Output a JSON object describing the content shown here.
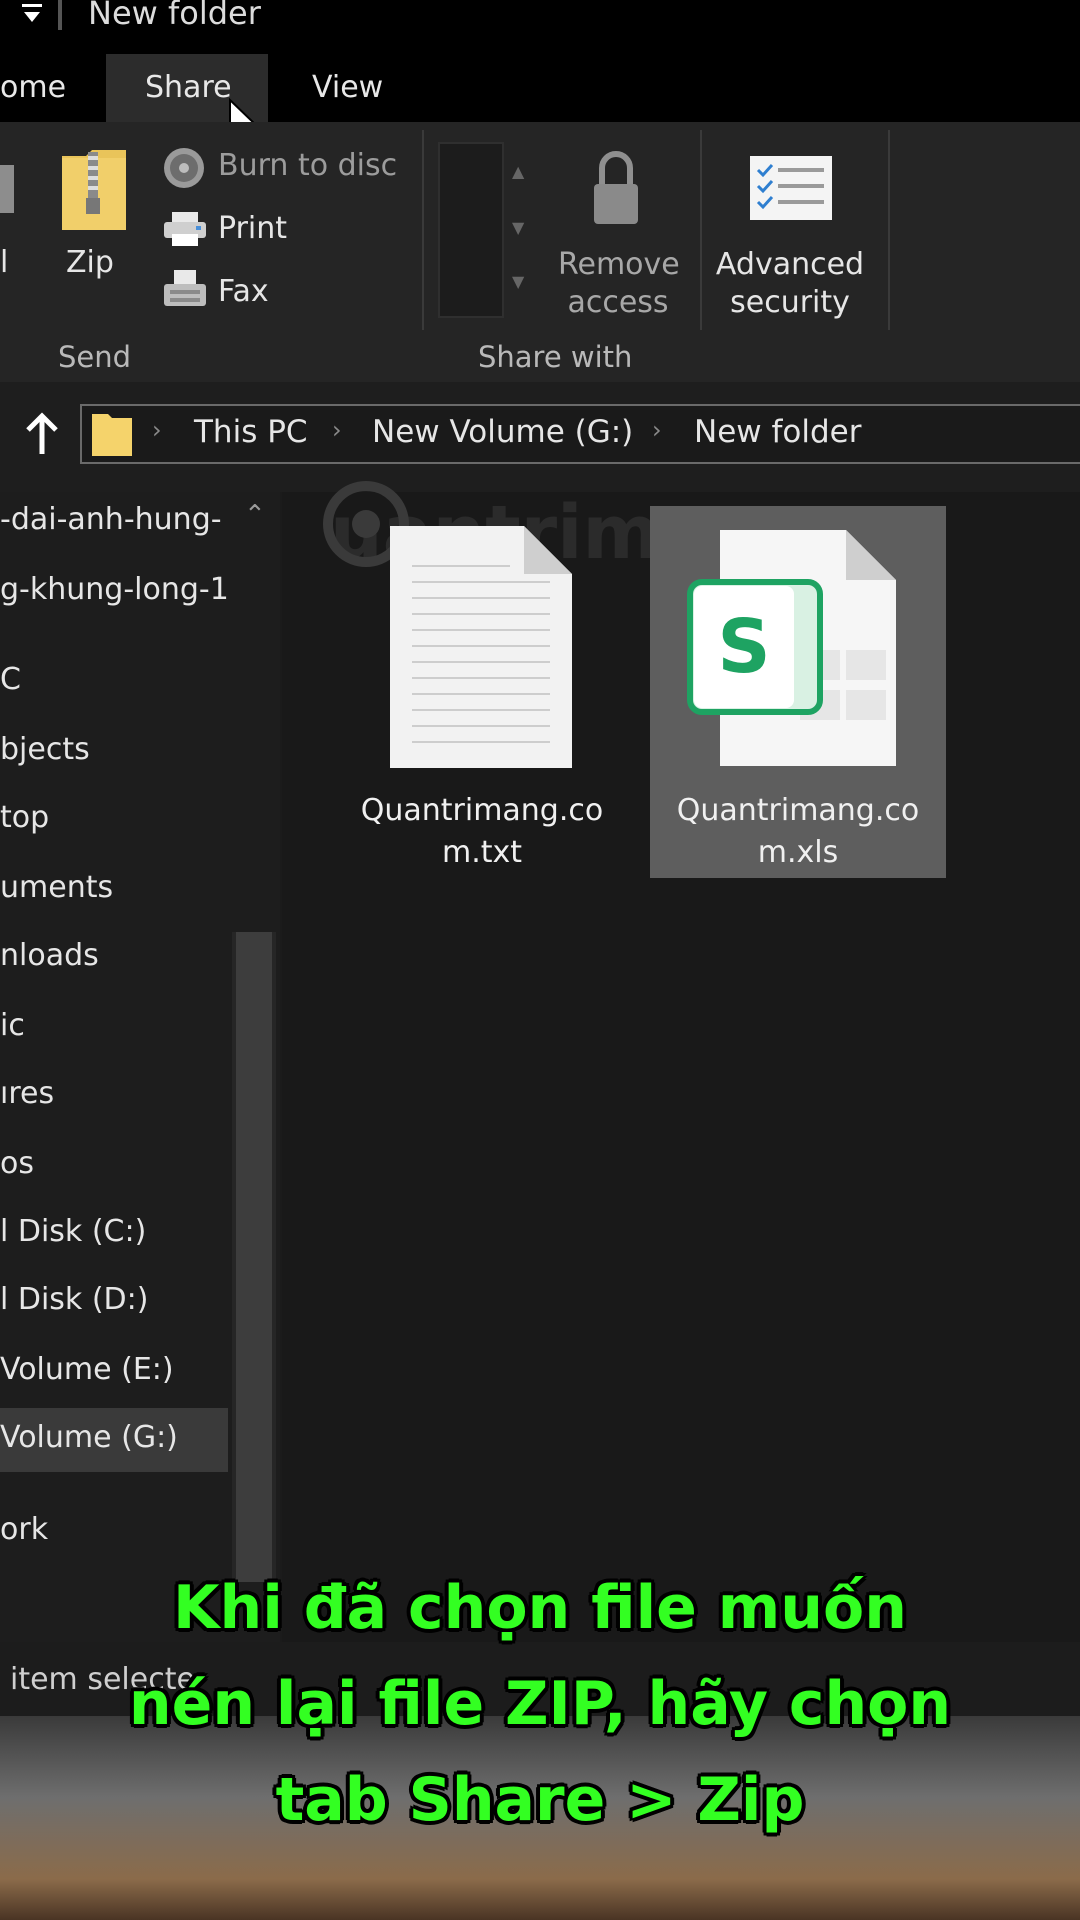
{
  "window": {
    "title": "New folder"
  },
  "tabs": [
    {
      "label": "ome"
    },
    {
      "label": "Share"
    },
    {
      "label": "View"
    }
  ],
  "ribbon": {
    "partial_left_label": "l",
    "zip_label": "Zip",
    "burn_label": "Burn to disc",
    "print_label": "Print",
    "fax_label": "Fax",
    "remove_access_line1": "Remove",
    "remove_access_line2": "access",
    "advanced_security_line1": "Advanced",
    "advanced_security_line2": "security",
    "group_send": "Send",
    "group_share_with": "Share with"
  },
  "address": {
    "crumbs": [
      "This PC",
      "New Volume (G:)",
      "New folder"
    ]
  },
  "nav": {
    "items": [
      "-dai-anh-hung-",
      "g-khung-long-1",
      "C",
      "bjects",
      "top",
      "uments",
      "nloads",
      "ic",
      "ıres",
      "os",
      "l Disk (C:)",
      "l Disk (D:)",
      " Volume (E:)",
      " Volume (G:)",
      "ork"
    ]
  },
  "files": [
    {
      "name_line1": "Quantrimang.co",
      "name_line2": "m.txt",
      "icon": "text-file-icon"
    },
    {
      "name_line1": "Quantrimang.co",
      "name_line2": "m.xls",
      "icon": "spreadsheet-file-icon"
    }
  ],
  "watermark": "uantrimang",
  "status": {
    "text": "item selecte"
  },
  "caption": {
    "line1": "Khi đã chọn file muốn",
    "line2": "nén lại file ZIP, hãy chọn",
    "line3": "tab Share > Zip"
  },
  "colors": {
    "caption": "#33ff22",
    "xls_green": "#1ea362"
  }
}
